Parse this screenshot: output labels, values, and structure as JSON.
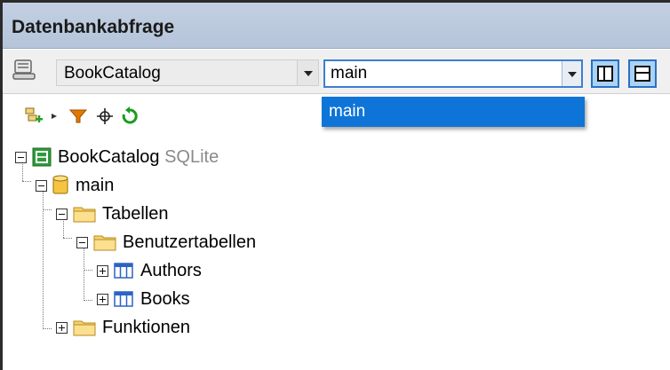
{
  "window": {
    "title": "Datenbankabfrage"
  },
  "toolbar": {
    "datasource": {
      "value": "BookCatalog"
    },
    "schema": {
      "value": "main",
      "options": [
        "main"
      ]
    },
    "icons": [
      "add-object-icon",
      "play-small-icon",
      "filter-icon",
      "locate-icon",
      "refresh-icon"
    ]
  },
  "tree": {
    "root": {
      "label": "BookCatalog",
      "type": "SQLite"
    },
    "schema": {
      "label": "main"
    },
    "tables": {
      "label": "Tabellen"
    },
    "user_tables": {
      "label": "Benutzertabellen"
    },
    "table_authors": {
      "label": "Authors"
    },
    "table_books": {
      "label": "Books"
    },
    "functions": {
      "label": "Funktionen"
    }
  },
  "colors": {
    "title_bg": "#b5c4da",
    "selection": "#0e74d7",
    "accent": "#2a6fc5"
  }
}
